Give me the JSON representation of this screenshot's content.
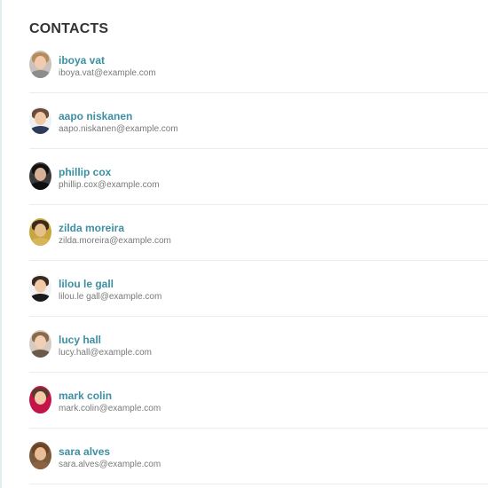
{
  "header": {
    "title": "CONTACTS"
  },
  "contacts": [
    {
      "name": "iboya vat",
      "email": "iboya.vat@example.com",
      "avatar_icon": "person-avatar-icon",
      "bg": "#c9c2bb",
      "hair": "#b98a5c",
      "skin": "#f1cbb0",
      "shirt": "#8c8c8c"
    },
    {
      "name": "aapo niskanen",
      "email": "aapo.niskanen@example.com",
      "avatar_icon": "person-avatar-icon",
      "bg": "#eef0f2",
      "hair": "#6b4b3a",
      "skin": "#efc8a6",
      "shirt": "#2c3b5a"
    },
    {
      "name": "phillip cox",
      "email": "phillip.cox@example.com",
      "avatar_icon": "person-avatar-icon",
      "bg": "#3a3a3a",
      "hair": "#111111",
      "skin": "#d8b095",
      "shirt": "#0f0f0f"
    },
    {
      "name": "zilda moreira",
      "email": "zilda.moreira@example.com",
      "avatar_icon": "person-avatar-icon",
      "bg": "#c7a63b",
      "hair": "#3b2a1a",
      "skin": "#e7bf8a",
      "shirt": "#d8b45b"
    },
    {
      "name": "lilou le gall",
      "email": "lilou.le gall@example.com",
      "avatar_icon": "person-avatar-icon",
      "bg": "#f2f2f2",
      "hair": "#3a2a1e",
      "skin": "#f0caa8",
      "shirt": "#1a1a1a"
    },
    {
      "name": "lucy hall",
      "email": "lucy.hall@example.com",
      "avatar_icon": "person-avatar-icon",
      "bg": "#d6cbc2",
      "hair": "#8a6a4a",
      "skin": "#f1cfb4",
      "shirt": "#6b5a4a"
    },
    {
      "name": "mark colin",
      "email": "mark.colin@example.com",
      "avatar_icon": "person-avatar-icon",
      "bg": "#c4154a",
      "hair": "#5a3a2a",
      "skin": "#f2caa8",
      "shirt": "#c4154a"
    },
    {
      "name": "sara alves",
      "email": "sara.alves@example.com",
      "avatar_icon": "person-avatar-icon",
      "bg": "#7a5a3a",
      "hair": "#6b4426",
      "skin": "#e8bd98",
      "shirt": "#8a6242"
    }
  ],
  "colors": {
    "accent": "#3d8fa3",
    "email_text": "#7a7a7a",
    "title_text": "#333333",
    "divider": "#ececec"
  }
}
